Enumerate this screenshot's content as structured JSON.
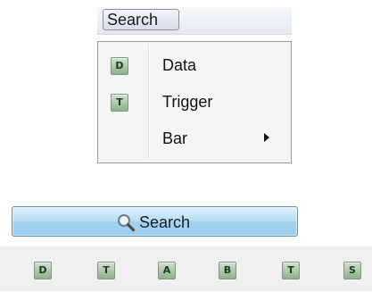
{
  "menubar": {
    "menu_title": "Search"
  },
  "dropdown": {
    "items": [
      {
        "badge": "D",
        "label": "Data"
      },
      {
        "badge": "T",
        "label": "Trigger"
      },
      {
        "badge": "",
        "label": "Bar",
        "has_submenu": true
      }
    ]
  },
  "search_button": {
    "label": "Search",
    "icon": "magnifier-icon"
  },
  "toolbar": {
    "badges": [
      "D",
      "T",
      "A",
      "B",
      "T",
      "S"
    ]
  },
  "colors": {
    "badge_fill": "#a9c7a6",
    "button_fill": "#b7ddf4",
    "toolbar_bg": "#f0f0f0"
  }
}
